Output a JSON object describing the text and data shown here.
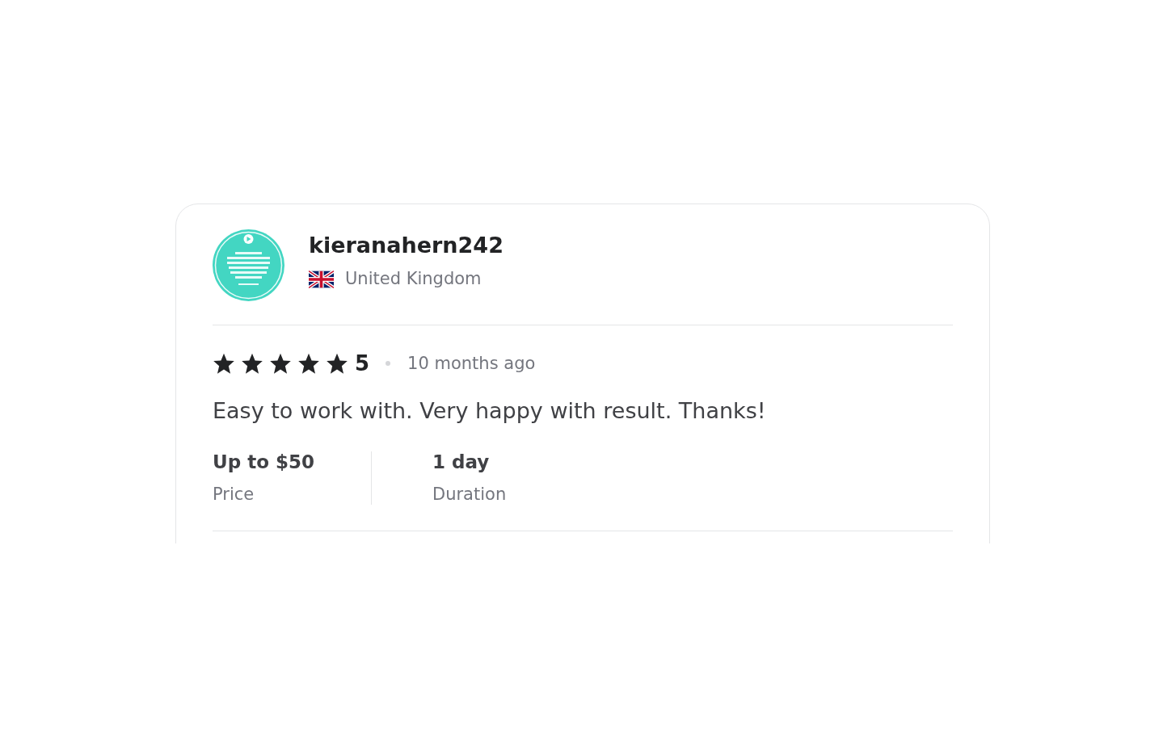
{
  "review": {
    "username": "kieranahern242",
    "country": "United Kingdom",
    "stars": 5,
    "rating": "5",
    "time": "10 months ago",
    "text": "Easy to work with. Very happy with result. Thanks!",
    "details": [
      {
        "value": "Up to $50",
        "label": "Price"
      },
      {
        "value": "1 day",
        "label": "Duration"
      }
    ]
  }
}
